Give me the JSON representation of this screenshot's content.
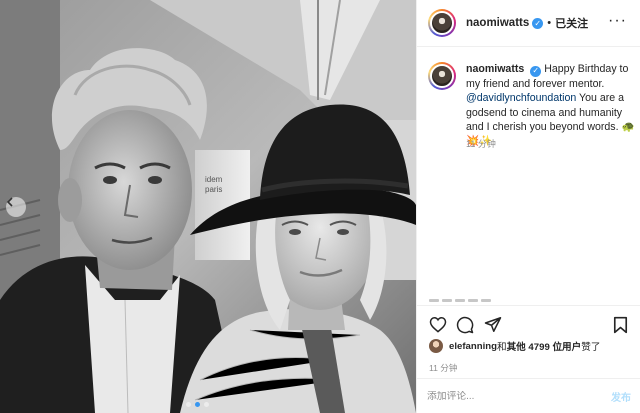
{
  "post": {
    "username": "naomiwatts",
    "follow_status": "已关注",
    "caption_pre": "Happy Birthday to my friend and forever mentor. ",
    "caption_tag": "@davidlynchfoundation",
    "caption_post": " You are a godsend to cinema and humanity and I cherish you beyond words. ",
    "caption_emoji": "🐢💥✨",
    "comment_time": "11 分钟",
    "likes_user": "elefanning",
    "likes_and": " 和 ",
    "likes_count": "其他 4799 位用户",
    "likes_suffix": " 赞了",
    "post_time": "11 分钟",
    "comment_placeholder": "添加评论...",
    "post_button": "发布",
    "photo_sign": "idem paris"
  },
  "icons": {
    "verified": "verified-badge-icon",
    "more": "more-options-icon",
    "like": "heart-icon",
    "comment": "comment-icon",
    "share": "share-icon",
    "save": "bookmark-icon",
    "prev": "chevron-left-icon"
  },
  "colors": {
    "accent": "#3897f0",
    "text": "#262626",
    "muted": "#8e8e8e",
    "link": "#00376b"
  }
}
